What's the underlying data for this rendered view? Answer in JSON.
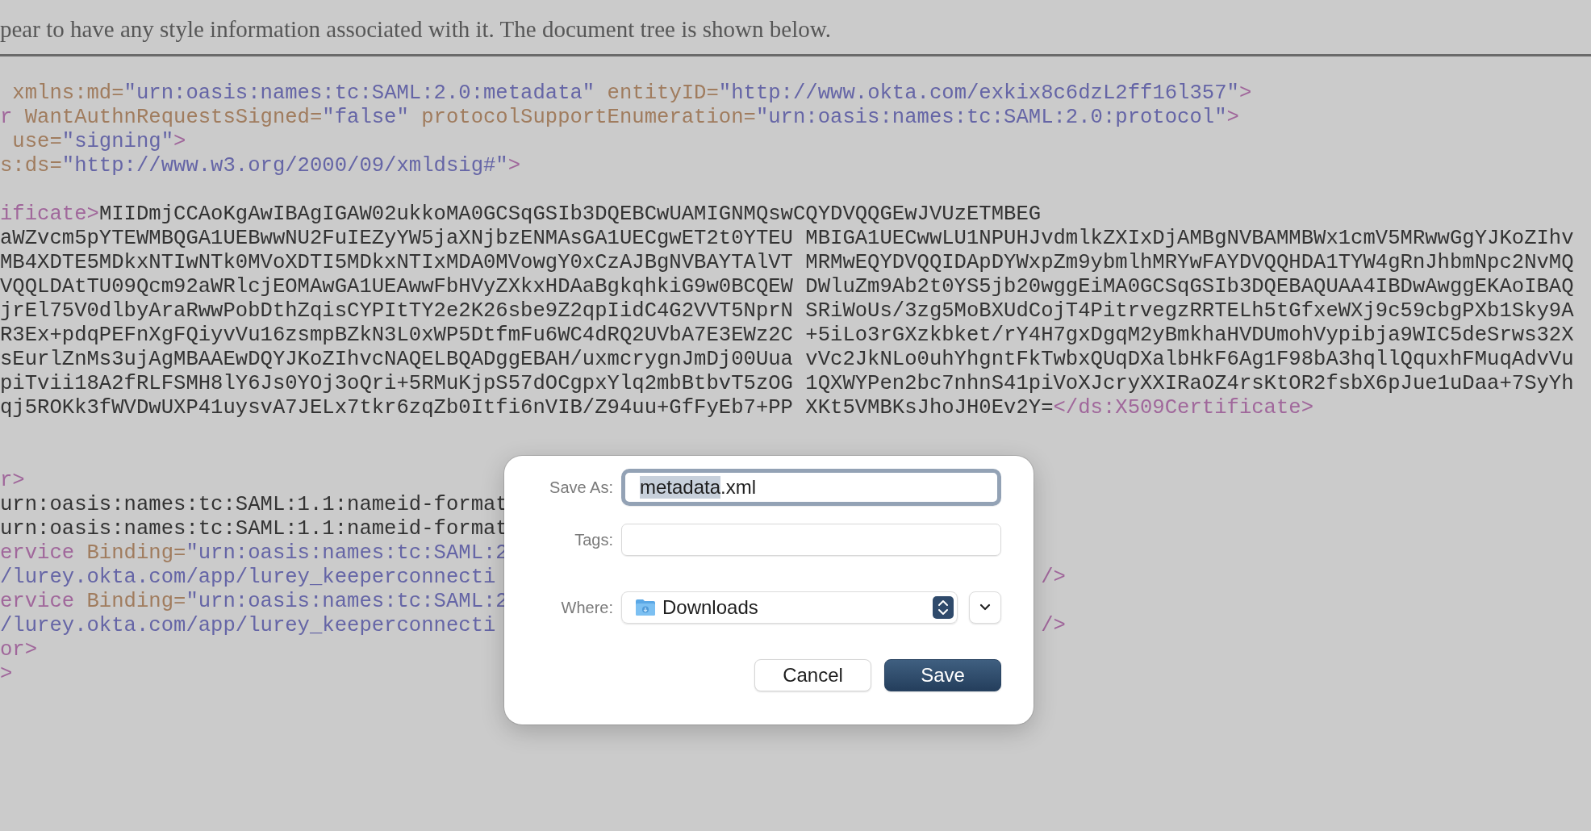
{
  "notice": "pear to have any style information associated with it. The document tree is shown below.",
  "xml_lines": [
    {
      "kind": "code",
      "segments": [
        {
          "kind": "attr",
          "text": " xmlns:md="
        },
        {
          "kind": "value",
          "text": "\"urn:oasis:names:tc:SAML:2.0:metadata\""
        },
        {
          "kind": "attr",
          "text": " entityID="
        },
        {
          "kind": "value",
          "text": "\"http://www.okta.com/exkix8c6dzL2ff16l357\""
        },
        {
          "kind": "tag",
          "text": ">"
        }
      ]
    },
    {
      "kind": "code",
      "segments": [
        {
          "kind": "tag",
          "text": "r"
        },
        {
          "kind": "attr",
          "text": " WantAuthnRequestsSigned="
        },
        {
          "kind": "value",
          "text": "\"false\""
        },
        {
          "kind": "attr",
          "text": " protocolSupportEnumeration="
        },
        {
          "kind": "value",
          "text": "\"urn:oasis:names:tc:SAML:2.0:protocol\""
        },
        {
          "kind": "tag",
          "text": ">"
        }
      ]
    },
    {
      "kind": "code",
      "segments": [
        {
          "kind": "attr",
          "text": " use="
        },
        {
          "kind": "value",
          "text": "\"signing\""
        },
        {
          "kind": "tag",
          "text": ">"
        }
      ]
    },
    {
      "kind": "code",
      "segments": [
        {
          "kind": "attr",
          "text": "s:ds="
        },
        {
          "kind": "value",
          "text": "\"http://www.w3.org/2000/09/xmldsig#\""
        },
        {
          "kind": "tag",
          "text": ">"
        }
      ]
    },
    {
      "kind": "blank"
    },
    {
      "kind": "code",
      "segments": [
        {
          "kind": "tag",
          "text": "ificate>"
        },
        {
          "kind": "text",
          "text": "MIIDmjCCAoKgAwIBAgIGAW02ukkoMA0GCSqGSIb3DQEBCwUAMIGNMQswCQYDVQQGEwJVUzETMBEG"
        }
      ]
    },
    {
      "kind": "code",
      "segments": [
        {
          "kind": "text",
          "text": "aWZvcm5pYTEWMBQGA1UEBwwNU2FuIEZyYW5jaXNjbzENMAsGA1UECgwET2t0YTEU MBIGA1UECwwLU1NPUHJvdmlkZXIxDjAMBgNVBAMMBWx1cmV5MRwwGgYJKoZIhv"
        }
      ]
    },
    {
      "kind": "code",
      "segments": [
        {
          "kind": "text",
          "text": "MB4XDTE5MDkxNTIwNTk0MVoXDTI5MDkxNTIxMDA0MVowgY0xCzAJBgNVBAYTAlVT MRMwEQYDVQQIDApDYWxpZm9ybmlhMRYwFAYDVQQHDA1TYW4gRnJhbmNpc2NvMQ"
        }
      ]
    },
    {
      "kind": "code",
      "segments": [
        {
          "kind": "text",
          "text": "VQQLDAtTU09Qcm92aWRlcjEOMAwGA1UEAwwFbHVyZXkxHDAaBgkqhkiG9w0BCQEW DWluZm9Ab2t0YS5jb20wggEiMA0GCSqGSIb3DQEBAQUAA4IBDwAwggEKAoIBAQ"
        }
      ]
    },
    {
      "kind": "code",
      "segments": [
        {
          "kind": "text",
          "text": "jrEl75V0dlbyAraRwwPobDthZqisCYPItTY2e2K26sbe9Z2qpIidC4G2VVT5NprN SRiWoUs/3zg5MoBXUdCojT4PitrvegzRRTELh5tGfxeWXj9c59cbgPXb1Sky9A"
        }
      ]
    },
    {
      "kind": "code",
      "segments": [
        {
          "kind": "text",
          "text": "R3Ex+pdqPEFnXgFQiyvVu16zsmpBZkN3L0xWP5DtfmFu6WC4dRQ2UVbA7E3EWz2C +5iLo3rGXzkbket/rY4H7gxDgqM2yBmkhaHVDUmohVypibja9WIC5deSrws32X"
        }
      ]
    },
    {
      "kind": "code",
      "segments": [
        {
          "kind": "text",
          "text": "sEurlZnMs3ujAgMBAAEwDQYJKoZIhvcNAQELBQADggEBAH/uxmcrygnJmDj00Uua vVc2JkNLo0uhYhgntFkTwbxQUqDXalbHkF6Ag1F98bA3hqllQquxhFMuqAdvVu"
        }
      ]
    },
    {
      "kind": "code",
      "segments": [
        {
          "kind": "text",
          "text": "piTvii18A2fRLFSMH8lY6Js0YOj3oQri+5RMuKjpS57dOCgpxYlq2mbBtbvT5zOG 1QXWYPen2bc7nhnS41piVoXJcryXXIRaOZ4rsKtOR2fsbX6pJue1uDaa+7SyYh"
        }
      ]
    },
    {
      "kind": "code",
      "segments": [
        {
          "kind": "text",
          "text": "qj5ROKk3fWVDwUXP41uysvA7JELx7tkr6zqZb0Itfi6nVIB/Z94uu+GfFyEb7+PP XKt5VMBKsJhoJH0Ev2Y="
        },
        {
          "kind": "tag",
          "text": "</ds:X509Certificate>"
        }
      ]
    },
    {
      "kind": "blank"
    },
    {
      "kind": "blank"
    },
    {
      "kind": "code",
      "segments": [
        {
          "kind": "tag",
          "text": "r>"
        }
      ]
    },
    {
      "kind": "code",
      "segments": [
        {
          "kind": "text",
          "text": "urn:oasis:names:tc:SAML:1.1:nameid-format"
        }
      ]
    },
    {
      "kind": "code",
      "segments": [
        {
          "kind": "text",
          "text": "urn:oasis:names:tc:SAML:1.1:nameid-format"
        }
      ]
    },
    {
      "kind": "code",
      "segments": [
        {
          "kind": "tag",
          "text": "ervice"
        },
        {
          "kind": "attr",
          "text": " Binding="
        },
        {
          "kind": "value",
          "text": "\"urn:oasis:names:tc:SAML:2"
        }
      ]
    },
    {
      "kind": "code",
      "segments": [
        {
          "kind": "value",
          "text": "/lurey.okta.com/app/lurey_keeperconnecti"
        }
      ],
      "tail": [
        {
          "kind": "tag",
          "text": "/>"
        }
      ]
    },
    {
      "kind": "code",
      "segments": [
        {
          "kind": "tag",
          "text": "ervice"
        },
        {
          "kind": "attr",
          "text": " Binding="
        },
        {
          "kind": "value",
          "text": "\"urn:oasis:names:tc:SAML:2"
        }
      ]
    },
    {
      "kind": "code",
      "segments": [
        {
          "kind": "value",
          "text": "/lurey.okta.com/app/lurey_keeperconnecti"
        }
      ],
      "tail": [
        {
          "kind": "tag",
          "text": "/>"
        }
      ]
    },
    {
      "kind": "code",
      "segments": [
        {
          "kind": "tag",
          "text": "or>"
        }
      ]
    },
    {
      "kind": "code",
      "segments": [
        {
          "kind": "tag",
          "text": ">"
        }
      ]
    }
  ],
  "save_dialog": {
    "save_as": {
      "label": "Save As:",
      "focused": true,
      "value_parts": [
        {
          "text": "metadata",
          "selected": true
        },
        {
          "text": ".xml",
          "selected": false
        }
      ]
    },
    "tags": {
      "label": "Tags:",
      "focused": false
    },
    "where": {
      "label": "Where:",
      "location": "Downloads",
      "expanded": false
    },
    "buttons": [
      {
        "label": "Cancel",
        "default": false
      },
      {
        "label": "Save",
        "default": true
      }
    ]
  }
}
